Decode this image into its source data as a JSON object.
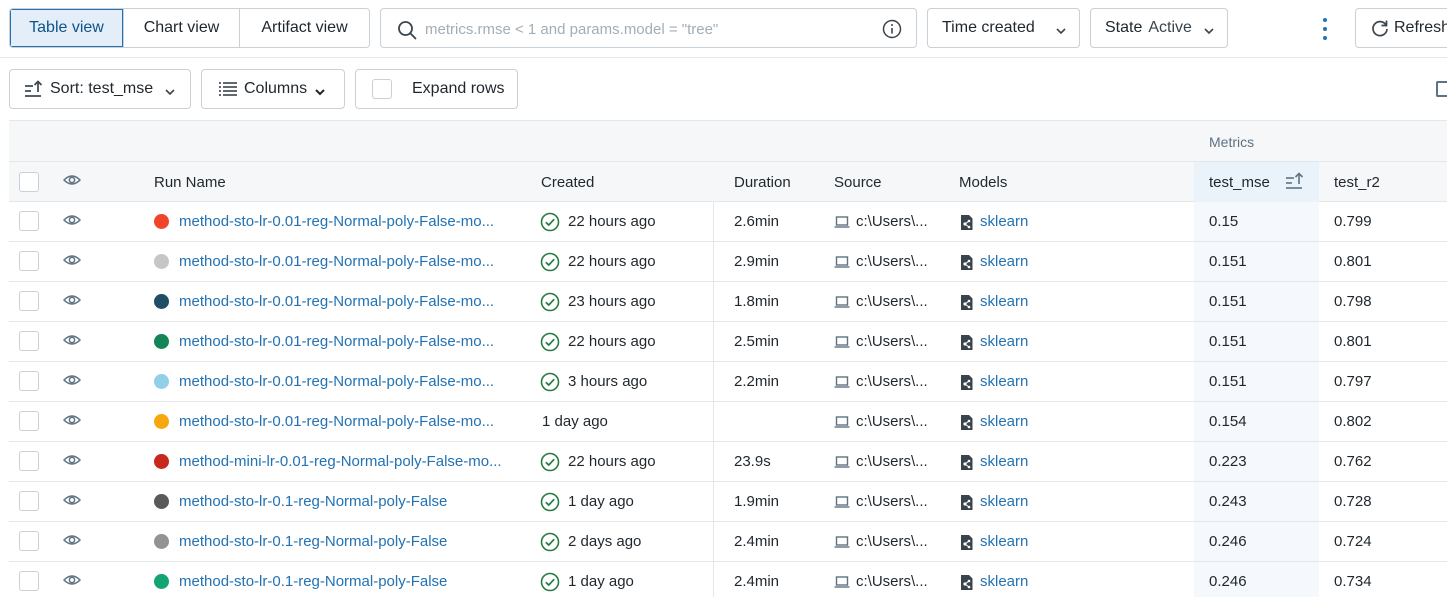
{
  "view_switch": {
    "table": "Table view",
    "chart": "Chart view",
    "artifact": "Artifact view"
  },
  "search": {
    "placeholder": "metrics.rmse < 1 and params.model = \"tree\"",
    "value": ""
  },
  "time_dropdown": {
    "label": "Time created"
  },
  "state_dropdown": {
    "label": "State",
    "value": "Active"
  },
  "refresh": {
    "label": "Refresh"
  },
  "toolbar2": {
    "sort_label": "Sort: test_mse",
    "columns_label": "Columns",
    "expand_label": "Expand rows"
  },
  "table": {
    "group_label": "Metrics",
    "headers": {
      "run_name": "Run Name",
      "created": "Created",
      "duration": "Duration",
      "source": "Source",
      "models": "Models",
      "test_mse": "test_mse",
      "test_r2": "test_r2"
    },
    "rows": [
      {
        "color": "#f0452b",
        "name": "method-sto-lr-0.01-reg-Normal-poly-False-mo...",
        "status": true,
        "created": "22 hours ago",
        "duration": "2.6min",
        "source": "c:\\Users\\...",
        "model": "sklearn",
        "test_mse": "0.15",
        "test_r2": "0.799"
      },
      {
        "color": "#c6c6c6",
        "name": "method-sto-lr-0.01-reg-Normal-poly-False-mo...",
        "status": true,
        "created": "22 hours ago",
        "duration": "2.9min",
        "source": "c:\\Users\\...",
        "model": "sklearn",
        "test_mse": "0.151",
        "test_r2": "0.801"
      },
      {
        "color": "#1f4e66",
        "name": "method-sto-lr-0.01-reg-Normal-poly-False-mo...",
        "status": true,
        "created": "23 hours ago",
        "duration": "1.8min",
        "source": "c:\\Users\\...",
        "model": "sklearn",
        "test_mse": "0.151",
        "test_r2": "0.798"
      },
      {
        "color": "#138556",
        "name": "method-sto-lr-0.01-reg-Normal-poly-False-mo...",
        "status": true,
        "created": "22 hours ago",
        "duration": "2.5min",
        "source": "c:\\Users\\...",
        "model": "sklearn",
        "test_mse": "0.151",
        "test_r2": "0.801"
      },
      {
        "color": "#92cfe8",
        "name": "method-sto-lr-0.01-reg-Normal-poly-False-mo...",
        "status": true,
        "created": "3 hours ago",
        "duration": "2.2min",
        "source": "c:\\Users\\...",
        "model": "sklearn",
        "test_mse": "0.151",
        "test_r2": "0.797"
      },
      {
        "color": "#f7a80e",
        "name": "method-sto-lr-0.01-reg-Normal-poly-False-mo...",
        "status": false,
        "created": "1 day ago",
        "duration": "",
        "source": "c:\\Users\\...",
        "model": "sklearn",
        "test_mse": "0.154",
        "test_r2": "0.802"
      },
      {
        "color": "#c8281e",
        "name": "method-mini-lr-0.01-reg-Normal-poly-False-mo...",
        "status": true,
        "created": "22 hours ago",
        "duration": "23.9s",
        "source": "c:\\Users\\...",
        "model": "sklearn",
        "test_mse": "0.223",
        "test_r2": "0.762"
      },
      {
        "color": "#5a5a5a",
        "name": "method-sto-lr-0.1-reg-Normal-poly-False",
        "status": true,
        "created": "1 day ago",
        "duration": "1.9min",
        "source": "c:\\Users\\...",
        "model": "sklearn",
        "test_mse": "0.243",
        "test_r2": "0.728"
      },
      {
        "color": "#939393",
        "name": "method-sto-lr-0.1-reg-Normal-poly-False",
        "status": true,
        "created": "2 days ago",
        "duration": "2.4min",
        "source": "c:\\Users\\...",
        "model": "sklearn",
        "test_mse": "0.246",
        "test_r2": "0.724"
      },
      {
        "color": "#14a471",
        "name": "method-sto-lr-0.1-reg-Normal-poly-False",
        "status": true,
        "created": "1 day ago",
        "duration": "2.4min",
        "source": "c:\\Users\\...",
        "model": "sklearn",
        "test_mse": "0.246",
        "test_r2": "0.734"
      }
    ]
  },
  "colors": {
    "accent": "#2272b4",
    "success": "#277c43",
    "border": "#c9d0d6"
  }
}
